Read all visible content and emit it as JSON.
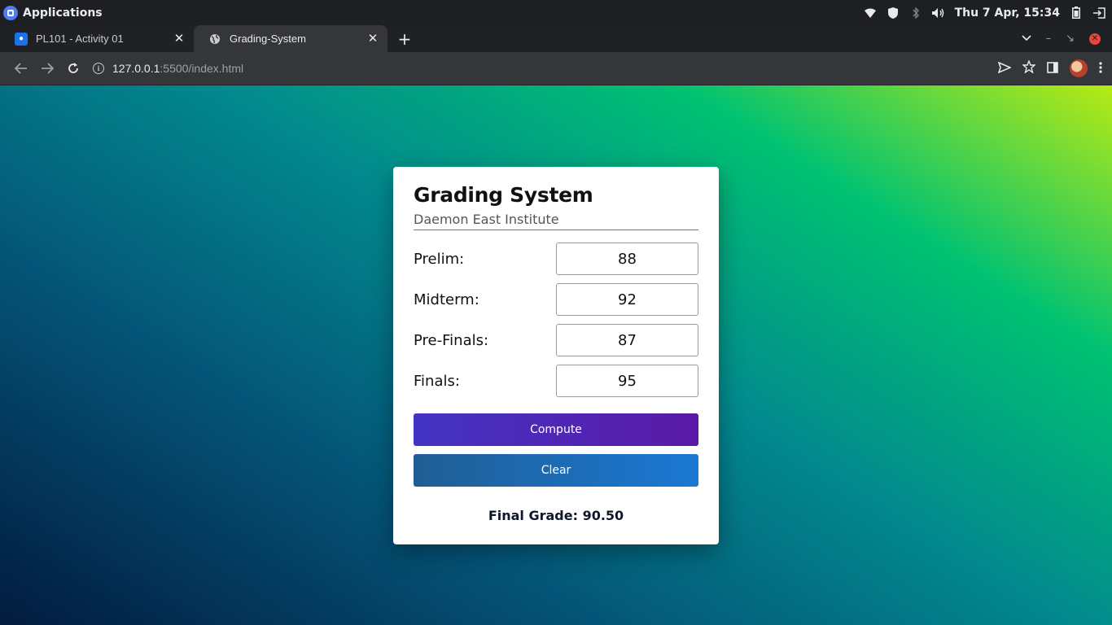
{
  "os_panel": {
    "apps_label": "Applications",
    "clock": "Thu  7 Apr, 15:34",
    "tray_icons": [
      "wifi-icon",
      "shield-icon",
      "bluetooth-icon",
      "volume-icon",
      "battery-icon",
      "logout-icon"
    ]
  },
  "browser": {
    "tabs": [
      {
        "title": "PL101 - Activity 01",
        "icon": "classroom-icon",
        "active": false
      },
      {
        "title": "Grading-System",
        "icon": "globe-icon",
        "active": true
      }
    ],
    "url_host": "127.0.0.1",
    "url_rest": ":5500/index.html"
  },
  "app": {
    "title": "Grading System",
    "subtitle": "Daemon East Institute",
    "fields": [
      {
        "label": "Prelim:",
        "value": "88"
      },
      {
        "label": "Midterm:",
        "value": "92"
      },
      {
        "label": "Pre-Finals:",
        "value": "87"
      },
      {
        "label": "Finals:",
        "value": "95"
      }
    ],
    "compute_label": "Compute",
    "clear_label": "Clear",
    "final_grade": "Final Grade: 90.50"
  },
  "colors": {
    "compute_start": "#4334c4",
    "compute_end": "#5b1aa6",
    "clear_start": "#1f5e94",
    "clear_end": "#1b78d4"
  }
}
